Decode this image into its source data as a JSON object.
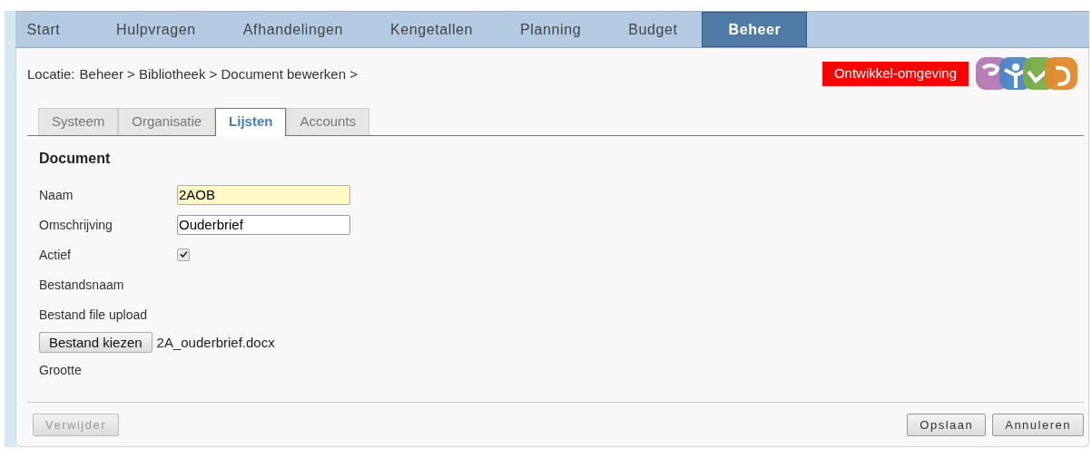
{
  "nav": [
    {
      "label": "Start",
      "selected": false
    },
    {
      "label": "Hulpvragen",
      "selected": false
    },
    {
      "label": "Afhandelingen",
      "selected": false
    },
    {
      "label": "Kengetallen",
      "selected": false
    },
    {
      "label": "Planning",
      "selected": false
    },
    {
      "label": "Budget",
      "selected": false
    },
    {
      "label": "Beheer",
      "selected": true
    }
  ],
  "breadcrumb": {
    "label": "Locatie:",
    "path": "Beheer > Bibliotheek > Document bewerken >"
  },
  "environment_badge": "Ontwikkel-omgeving",
  "tabs": [
    {
      "label": "Systeem",
      "selected": false
    },
    {
      "label": "Organisatie",
      "selected": false
    },
    {
      "label": "Lijsten",
      "selected": true
    },
    {
      "label": "Accounts",
      "selected": false
    }
  ],
  "form": {
    "title": "Document",
    "fields": [
      {
        "kind": "text",
        "label": "Naam",
        "value": "2AOB",
        "focused": true
      },
      {
        "kind": "text",
        "label": "Omschrijving",
        "value": "Ouderbrief",
        "focused": false
      },
      {
        "kind": "checkbox",
        "label": "Actief",
        "checked": true
      },
      {
        "kind": "static",
        "label": "Bestandsnaam"
      },
      {
        "kind": "file",
        "label": "Bestand file upload",
        "button": "Bestand kiezen",
        "file_name": "2A_ouderbrief.docx"
      },
      {
        "kind": "static",
        "label": "Grootte"
      }
    ]
  },
  "left_buttons": [
    {
      "label": "Verwijder",
      "disabled": true
    }
  ],
  "right_buttons": [
    {
      "label": "Opslaan",
      "disabled": false
    },
    {
      "label": "Annuleren",
      "disabled": false
    }
  ]
}
